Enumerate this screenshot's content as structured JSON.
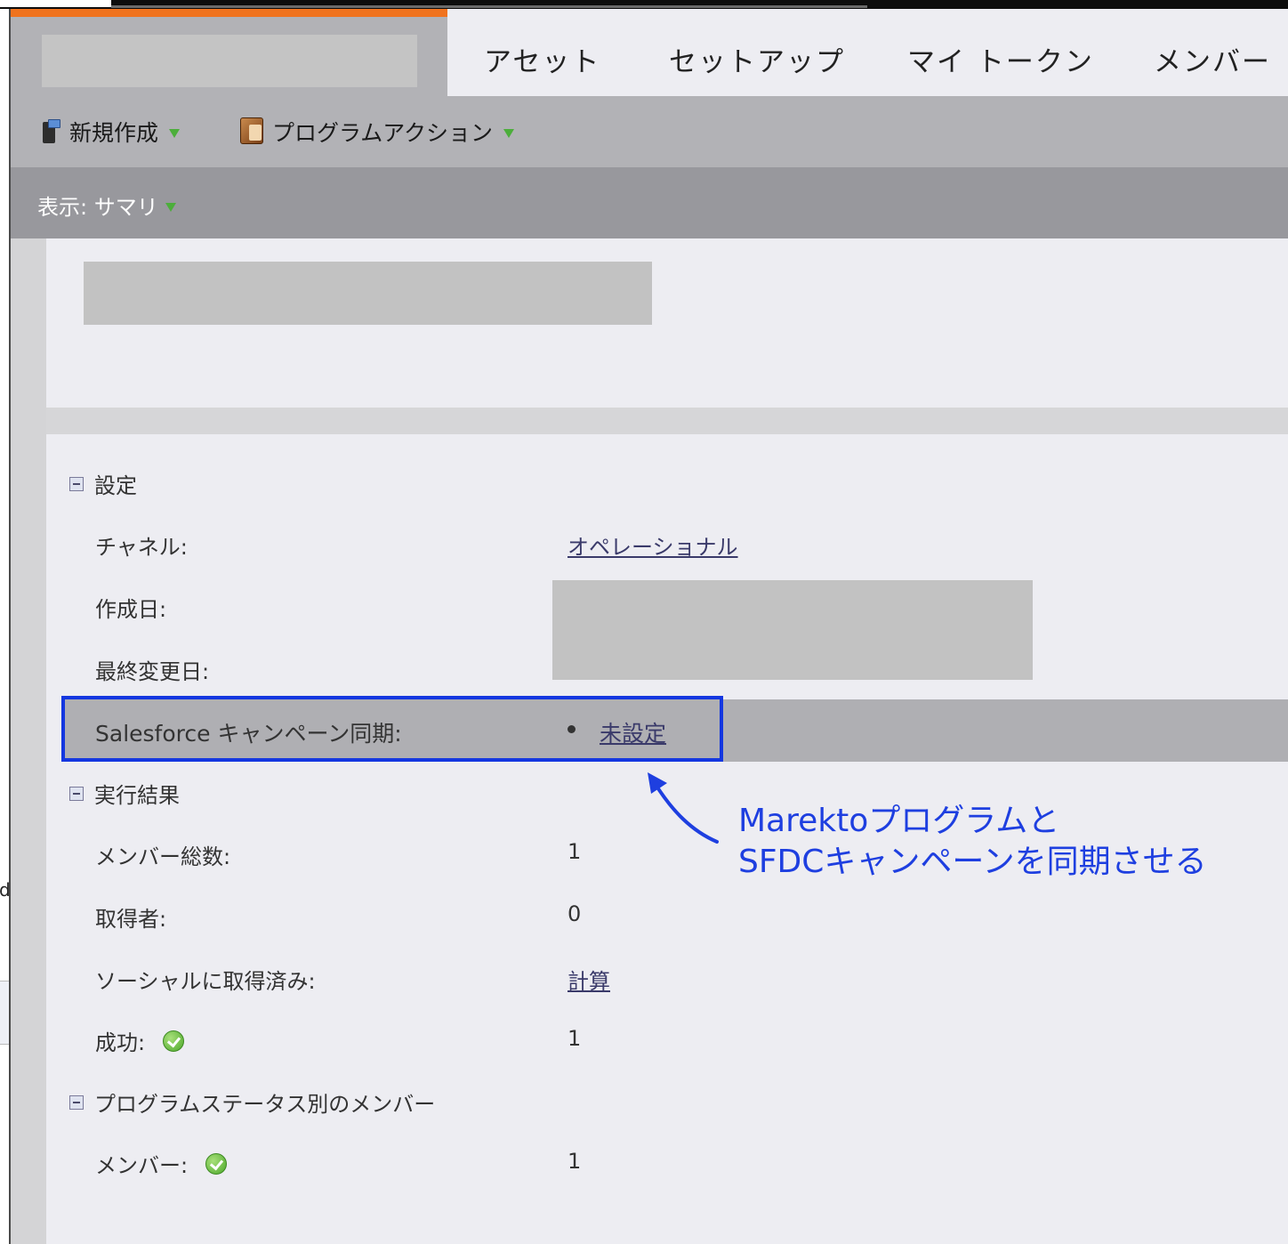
{
  "top_tabs": [
    "アセット",
    "セットアップ",
    "マイ トークン",
    "メンバー"
  ],
  "toolbar": {
    "new_label": "新規作成",
    "program_actions_label": "プログラムアクション"
  },
  "view": {
    "label": "表示: サマリ"
  },
  "sections": {
    "settings": {
      "title": "設定",
      "channel_label": "チャネル:",
      "channel_value": "オペレーショナル",
      "created_label": "作成日:",
      "modified_label": "最終変更日:",
      "sfdc_sync_label": "Salesforce キャンペーン同期:",
      "sfdc_sync_value": "未設定"
    },
    "results": {
      "title": "実行結果",
      "members_total_label": "メンバー総数:",
      "members_total_value": "1",
      "acquired_label": "取得者:",
      "acquired_value": "0",
      "social_label": "ソーシャルに取得済み:",
      "social_value": "計算",
      "success_label": "成功:",
      "success_value": "1"
    },
    "status": {
      "title": "プログラムステータス別のメンバー",
      "member_label": "メンバー:",
      "member_value": "1"
    }
  },
  "annotation": {
    "line1": "Marektoプログラムと",
    "line2": "SFDCキャンペーンを同期させる"
  },
  "left_stub_text": "d",
  "colors": {
    "accent_orange": "#f0731e",
    "highlight_blue": "#1437e0",
    "annotation_blue": "#1e3fe0",
    "caret_green": "#4cae3b"
  }
}
